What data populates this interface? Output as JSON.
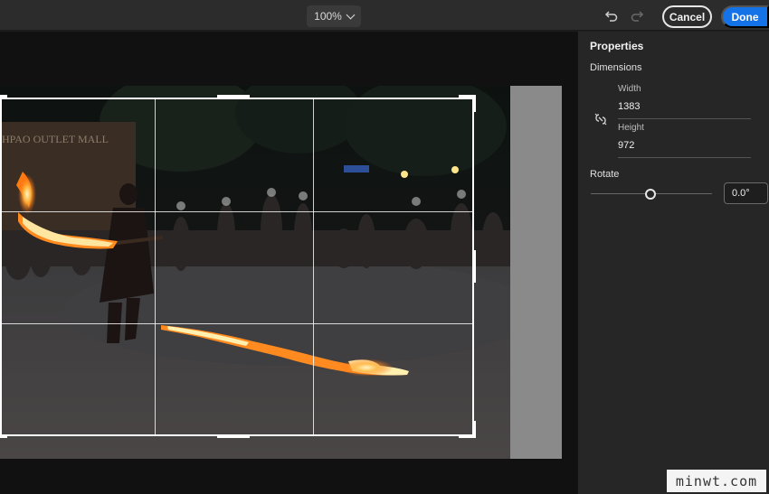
{
  "toolbar": {
    "zoom_value": "100%",
    "undo_icon": "undo-icon",
    "redo_icon": "redo-icon",
    "cancel_label": "Cancel",
    "done_label": "Done"
  },
  "properties": {
    "title": "Properties",
    "dimensions_label": "Dimensions",
    "link_icon": "unlink-icon",
    "width_label": "Width",
    "width_value": "1383",
    "height_label": "Height",
    "height_value": "972",
    "rotate_label": "Rotate",
    "rotate_value": "0.0°",
    "rotate_slider_fraction": 0.5
  },
  "photo": {
    "sign_text": "HPAO OUTLET MALL"
  },
  "watermark": "minwt.com",
  "colors": {
    "accent": "#1473e6",
    "panel_bg": "#262626",
    "topbar_bg": "#2c2c2c"
  }
}
